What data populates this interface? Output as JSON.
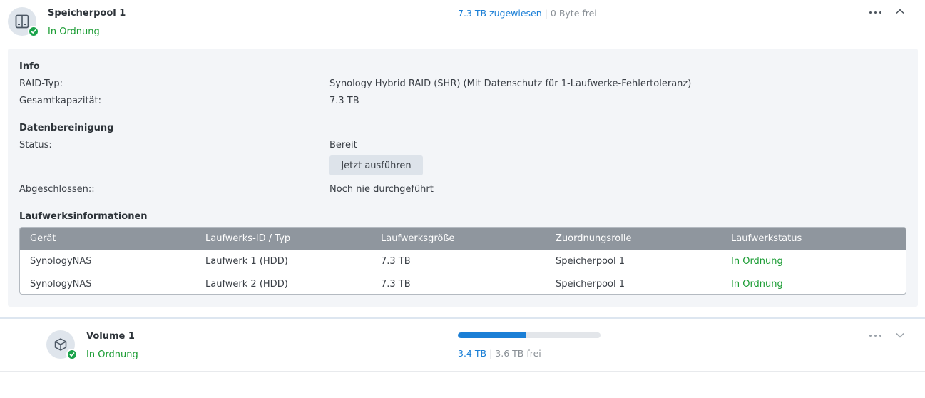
{
  "pool": {
    "name": "Speicherpool 1",
    "status": "In Ordnung",
    "allocated": "7.3 TB zugewiesen",
    "free": "0 Byte frei",
    "separator": "|"
  },
  "info": {
    "section_title": "Info",
    "raid_label": "RAID-Typ:",
    "raid_value": "Synology Hybrid RAID (SHR) (Mit Datenschutz für 1-Laufwerke-Fehlertoleranz)",
    "capacity_label": "Gesamtkapazität:",
    "capacity_value": "7.3 TB"
  },
  "scrubbing": {
    "section_title": "Datenbereinigung",
    "status_label": "Status:",
    "status_value": "Bereit",
    "run_button": "Jetzt ausführen",
    "completed_label": "Abgeschlossen::",
    "completed_value": "Noch nie durchgeführt"
  },
  "drives": {
    "section_title": "Laufwerksinformationen",
    "columns": [
      "Gerät",
      "Laufwerks-ID / Typ",
      "Laufwerksgröße",
      "Zuordnungsrolle",
      "Laufwerkstatus"
    ],
    "rows": [
      [
        "SynologyNAS",
        "Laufwerk 1 (HDD)",
        "7.3 TB",
        "Speicherpool 1",
        "In Ordnung"
      ],
      [
        "SynologyNAS",
        "Laufwerk 2 (HDD)",
        "7.3 TB",
        "Speicherpool 1",
        "In Ordnung"
      ]
    ]
  },
  "volume": {
    "name": "Volume 1",
    "status": "In Ordnung",
    "used": "3.4 TB",
    "free": "3.6 TB frei",
    "separator": "|",
    "usage_fraction": 0.48
  },
  "icons": {
    "pool": "storage-pool-icon",
    "volume": "volume-cube-icon",
    "status": "check-icon",
    "more": "more-icon",
    "collapse": "chevron-up-icon",
    "expand": "chevron-down-icon"
  },
  "colors": {
    "ok_green": "#1a9c33",
    "accent_blue": "#1b7fd6",
    "table_header": "#8f969e",
    "panel_bg": "#f3f5f8"
  }
}
